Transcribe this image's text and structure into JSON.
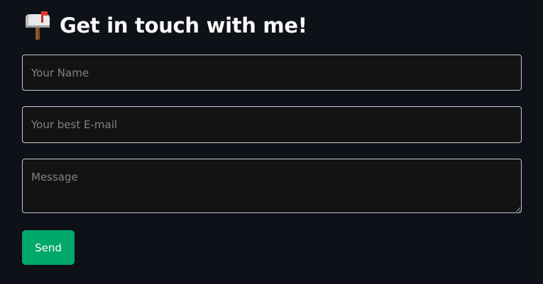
{
  "heading": {
    "icon": "mailbox-with-raised-flag-icon",
    "title": "Get in touch with me!"
  },
  "form": {
    "name_placeholder": "Your Name",
    "email_placeholder": "Your best E-mail",
    "message_placeholder": "Message",
    "send_label": "Send"
  },
  "colors": {
    "background": "#0e1117",
    "field_background": "#131313",
    "field_border": "#c5c8ce",
    "button": "#00a86b",
    "text": "#fafafa"
  }
}
